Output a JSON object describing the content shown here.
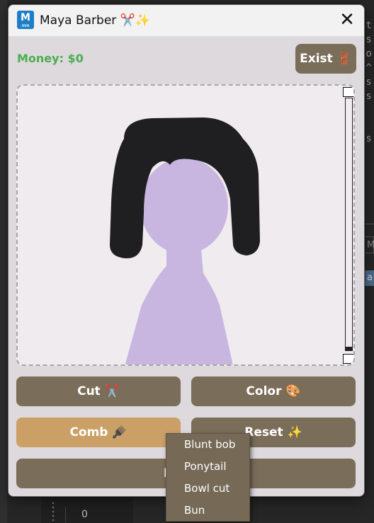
{
  "background": {
    "right_code_text": "st\nts\nlo\n^^\nts\nts\n\n\nts\n\n\nt\n",
    "panel_letter": "M",
    "highlight_letter": "a",
    "counter_value": "0"
  },
  "window": {
    "app_icon_letter": "M",
    "app_icon_sub": "AVA",
    "title": "Maya Barber ✂️✨",
    "close_glyph": "✕"
  },
  "header": {
    "money": "Money: $0",
    "exist_button": "Exist 🚪"
  },
  "canvas": {
    "hair_color": "#1f1e21",
    "skin_color": "#c8b6e0",
    "background_color": "#efebee"
  },
  "actions": {
    "cut": "Cut ✂️",
    "color": "Color 🎨",
    "comb": "Comb 🪮",
    "reset": "Reset ✨",
    "next": "Next C"
  },
  "style_menu": {
    "options": [
      "Blunt bob",
      "Ponytail",
      "Bowl cut",
      "Bun"
    ]
  },
  "colors": {
    "money_green": "#4cae4f",
    "button_brown": "#7a6d59",
    "active_button": "#cba066"
  }
}
